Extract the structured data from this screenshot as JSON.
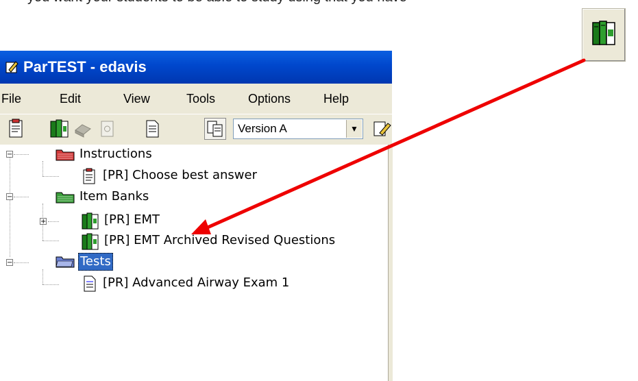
{
  "intro_text": "you want your students to be able to study using that you have",
  "window": {
    "title": "ParTEST - edavis",
    "menu": [
      "File",
      "Edit",
      "View",
      "Tools",
      "Options",
      "Help"
    ],
    "version_select": {
      "value": "Version A"
    }
  },
  "tree": {
    "instructions": {
      "label": "Instructions",
      "children": [
        "[PR] Choose best answer"
      ]
    },
    "item_banks": {
      "label": "Item Banks",
      "children": [
        "[PR] EMT",
        "[PR] EMT Archived Revised Questions"
      ]
    },
    "tests": {
      "label": "Tests",
      "children": [
        "[PR] Advanced Airway Exam 1"
      ]
    }
  },
  "colors": {
    "titlebar": "#0047cc",
    "selection": "#316ac5",
    "annotation_arrow": "#ee0000"
  },
  "icons": {
    "floating": "item-bank-books-icon"
  }
}
